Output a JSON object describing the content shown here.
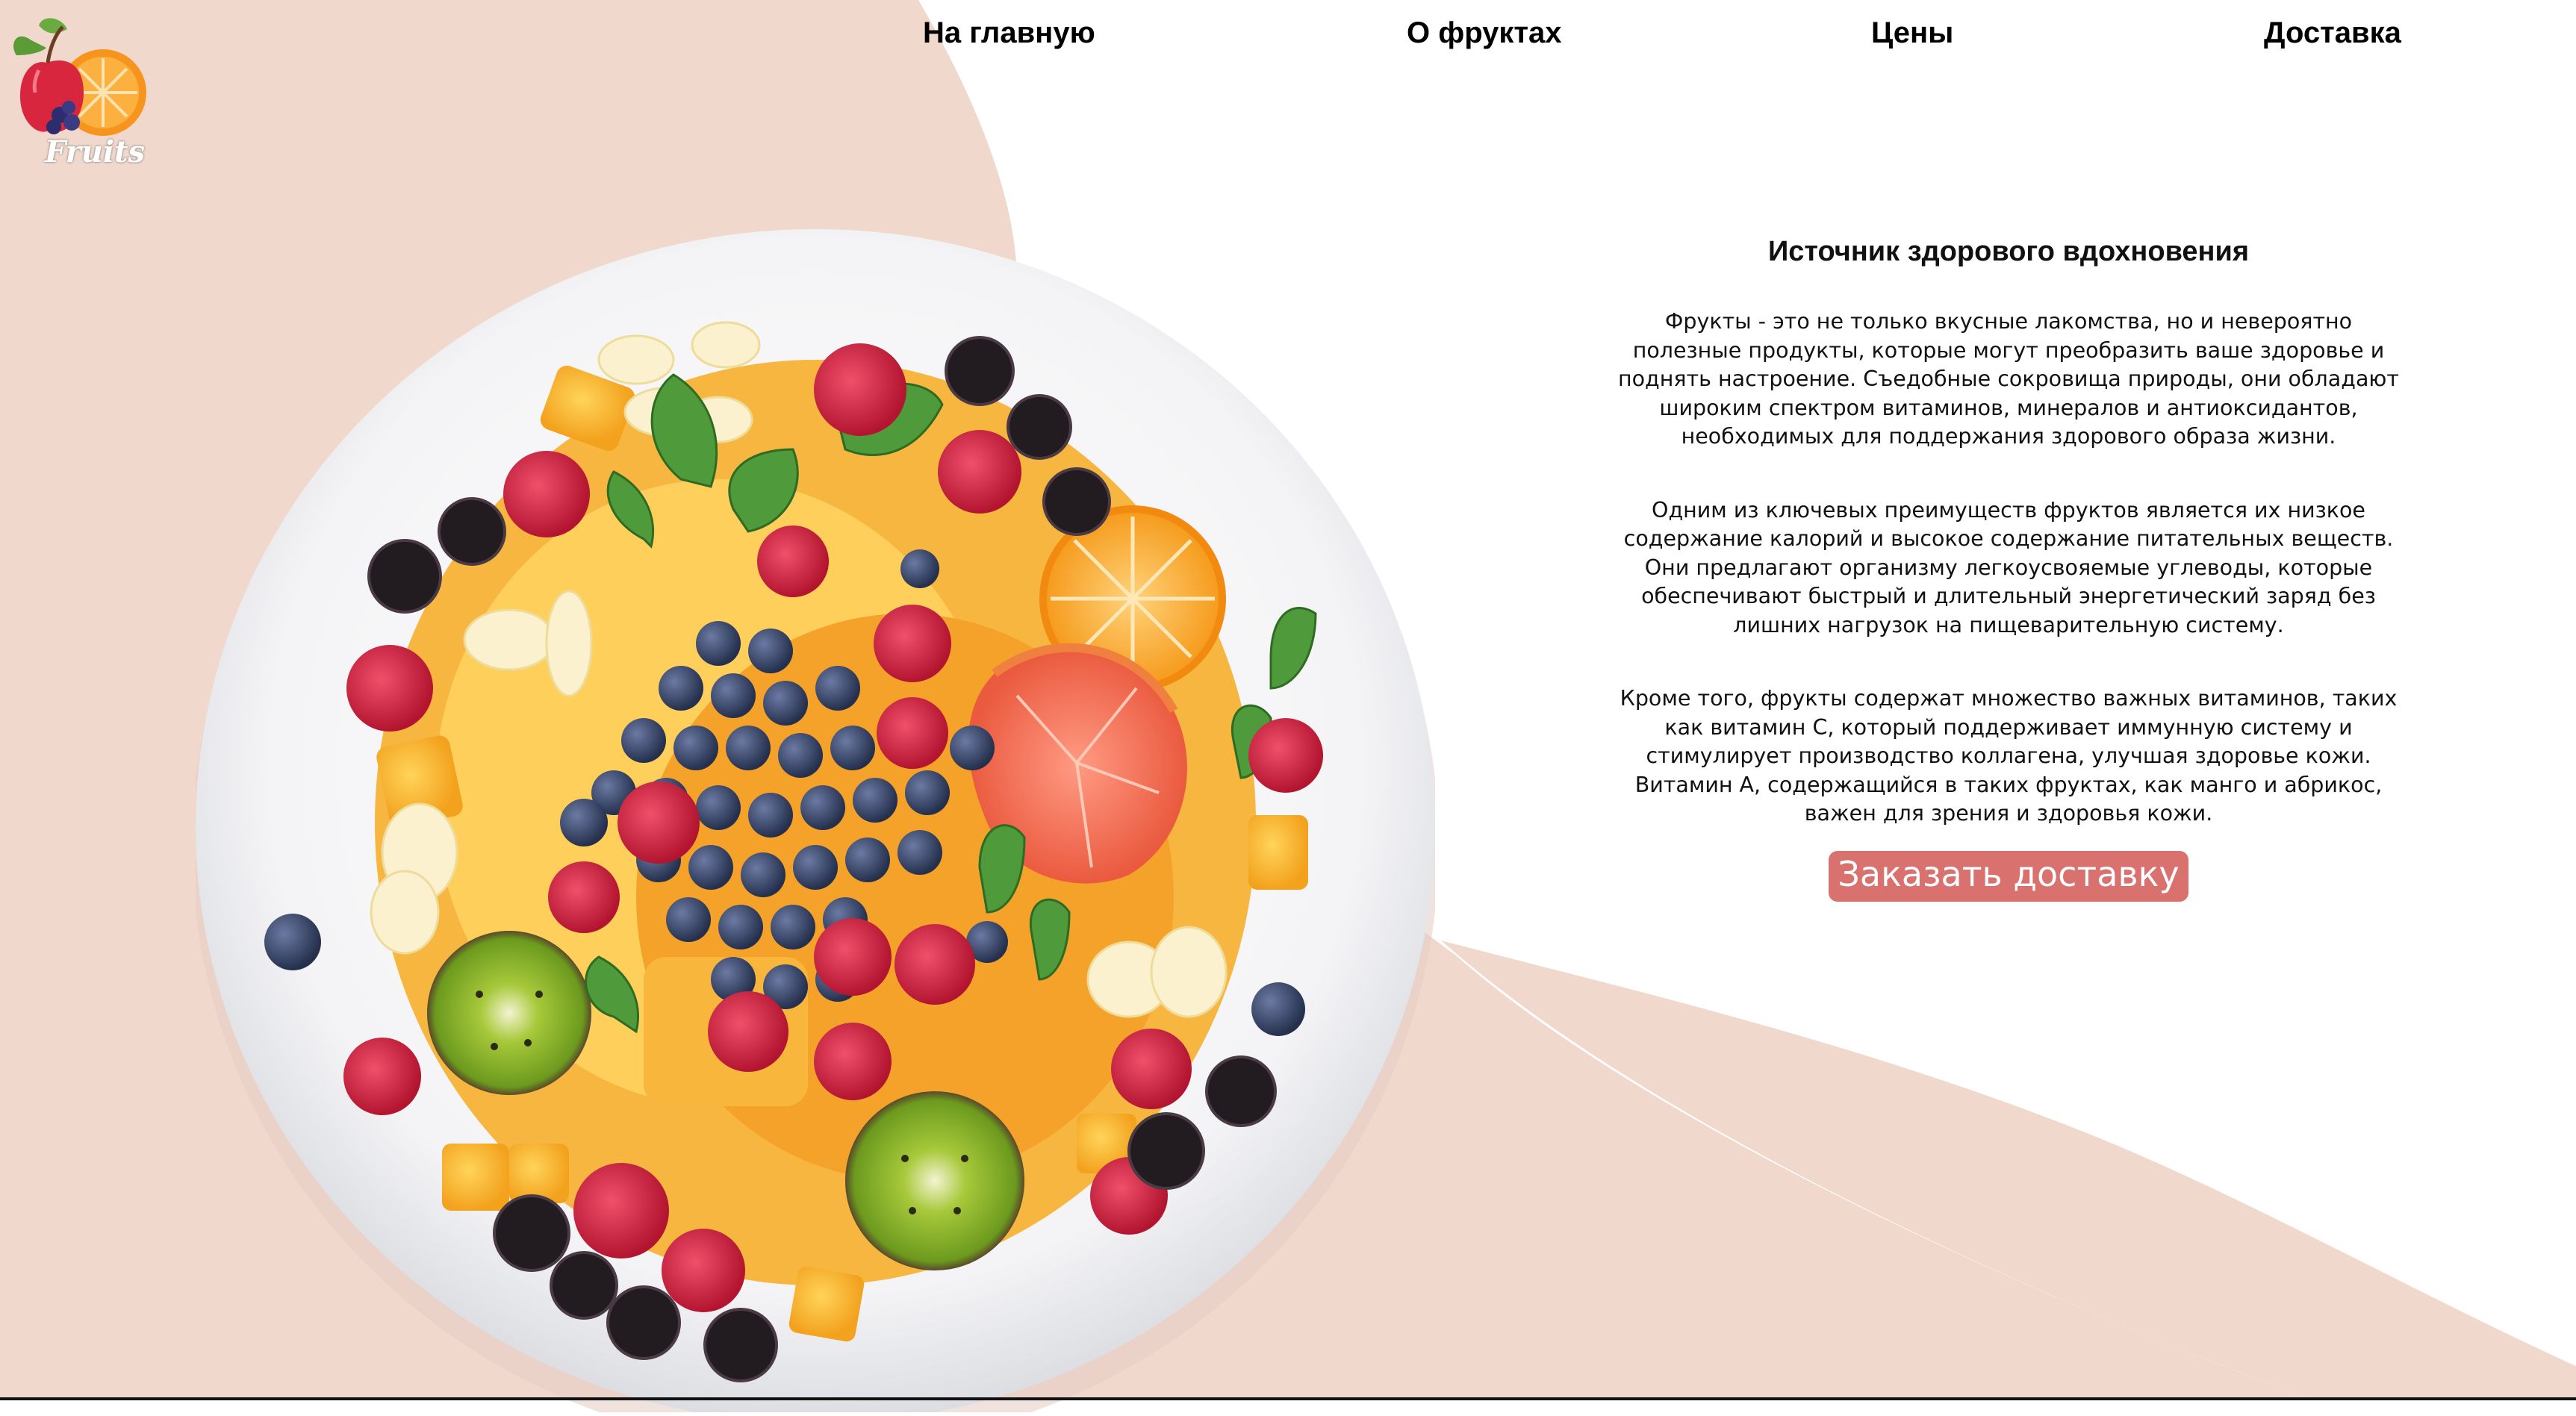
{
  "colors": {
    "peach_background": "#f0d8cd",
    "page_background": "#ffffff",
    "button_background": "#d9716f",
    "button_text": "#ffffff",
    "text": "#111111"
  },
  "logo": {
    "text": "Fruits",
    "icon": "fruit-basket-logo-icon"
  },
  "nav": {
    "home": "На главную",
    "about": "О фруктах",
    "prices": "Цены",
    "delivery": "Доставка"
  },
  "hero": {
    "image": "fruit-salad-plate-image",
    "title": "Источник здорового вдохновения",
    "paragraph1": "Фрукты - это не только вкусные лакомства, но и невероятно полезные продукты, которые могут преобразить ваше здоровье и поднять настроение. Съедобные сокровища природы, они обладают широким спектром витаминов, минералов и антиоксидантов, необходимых для поддержания здорового образа жизни.",
    "paragraph2": "Одним из ключевых преимуществ фруктов является их низкое содержание калорий и высокое содержание питательных веществ. Они предлагают организму легкоусвояемые углеводы, которые обеспечивают быстрый и длительный энергетический заряд без лишних нагрузок на пищеварительную систему.",
    "paragraph3": "Кроме того, фрукты содержат множество важных витаминов, таких как витамин С, который поддерживает иммунную систему и стимулирует производство коллагена, улучшая здоровье кожи. Витамин А, содержащийся в таких фруктах, как манго и абрикос, важен для зрения и здоровья кожи.",
    "button_label": "Заказать доставку"
  }
}
